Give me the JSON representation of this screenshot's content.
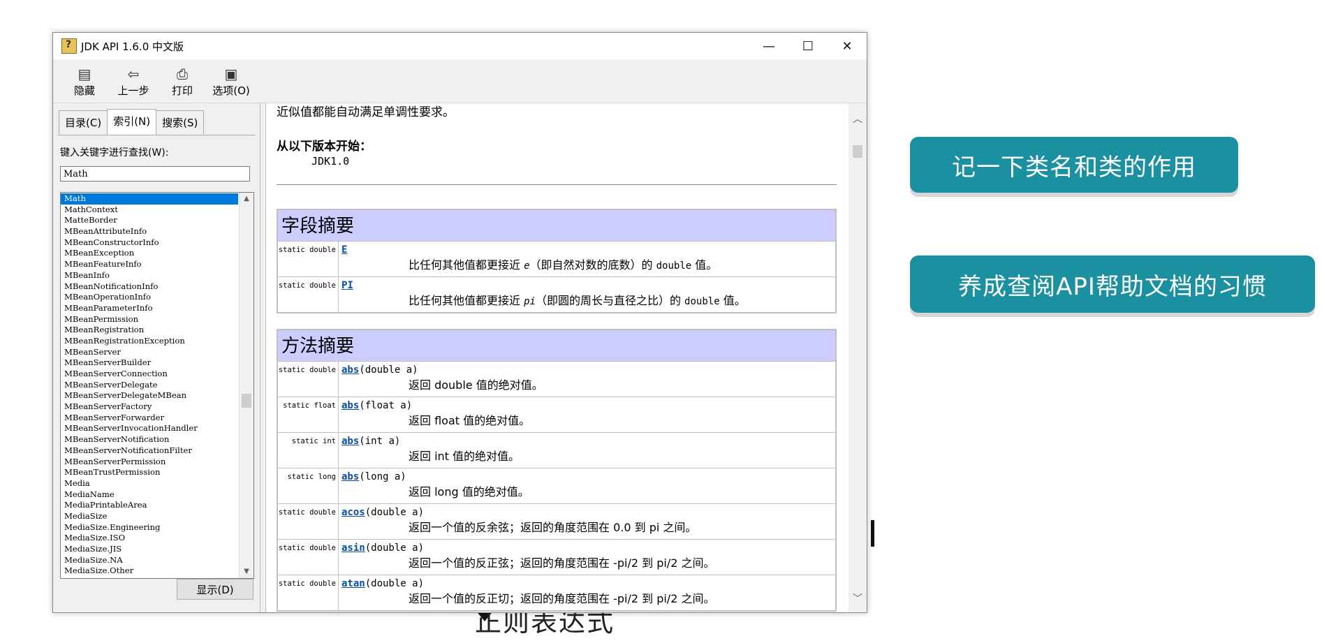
{
  "window": {
    "title": "JDK API 1.6.0 中文版",
    "controls": {
      "minimize": "—",
      "maximize": "☐",
      "close": "✕"
    }
  },
  "toolbar": [
    {
      "icon": "hide-icon",
      "label": "隐藏"
    },
    {
      "icon": "back-icon",
      "label": "上一步"
    },
    {
      "icon": "print-icon",
      "label": "打印"
    },
    {
      "icon": "options-icon",
      "label": "选项(O)"
    }
  ],
  "tabs": [
    {
      "label": "目录(C)",
      "active": false
    },
    {
      "label": "索引(N)",
      "active": true
    },
    {
      "label": "搜索(S)",
      "active": false
    }
  ],
  "index": {
    "search_label": "键入关键字进行查找(W):",
    "search_value": "Math",
    "items": [
      "Math",
      "MathContext",
      "MatteBorder",
      "MBeanAttributeInfo",
      "MBeanConstructorInfo",
      "MBeanException",
      "MBeanFeatureInfo",
      "MBeanInfo",
      "MBeanNotificationInfo",
      "MBeanOperationInfo",
      "MBeanParameterInfo",
      "MBeanPermission",
      "MBeanRegistration",
      "MBeanRegistrationException",
      "MBeanServer",
      "MBeanServerBuilder",
      "MBeanServerConnection",
      "MBeanServerDelegate",
      "MBeanServerDelegateMBean",
      "MBeanServerFactory",
      "MBeanServerForwarder",
      "MBeanServerInvocationHandler",
      "MBeanServerNotification",
      "MBeanServerNotificationFilter",
      "MBeanServerPermission",
      "MBeanTrustPermission",
      "Media",
      "MediaName",
      "MediaPrintableArea",
      "MediaSize",
      "MediaSize.Engineering",
      "MediaSize.ISO",
      "MediaSize.JIS",
      "MediaSize.NA",
      "MediaSize.Other"
    ],
    "selected": "Math",
    "show_button": "显示(D)"
  },
  "content": {
    "intro_line": "近似值都能自动满足单调性要求。",
    "since_label": "从以下版本开始：",
    "since_value": "JDK1.0",
    "field_summary": {
      "title": "字段摘要",
      "rows": [
        {
          "modifier": "static double",
          "name": "E",
          "params": "",
          "desc_pre": "比任何其他值都更接近 ",
          "desc_var": "e",
          "desc_mid": "（即自然对数的底数）的 ",
          "desc_code": "double",
          "desc_post": " 值。"
        },
        {
          "modifier": "static double",
          "name": "PI",
          "params": "",
          "desc_pre": "比任何其他值都更接近 ",
          "desc_var": "pi",
          "desc_mid": "（即圆的周长与直径之比）的 ",
          "desc_code": "double",
          "desc_post": " 值。"
        }
      ]
    },
    "method_summary": {
      "title": "方法摘要",
      "rows": [
        {
          "modifier": "static double",
          "name": "abs",
          "params": "(double a)",
          "desc": "返回 double 值的绝对值。"
        },
        {
          "modifier": "static float",
          "name": "abs",
          "params": "(float a)",
          "desc": "返回 float 值的绝对值。"
        },
        {
          "modifier": "static int",
          "name": "abs",
          "params": "(int a)",
          "desc": "返回 int 值的绝对值。"
        },
        {
          "modifier": "static long",
          "name": "abs",
          "params": "(long a)",
          "desc": "返回 long 值的绝对值。"
        },
        {
          "modifier": "static double",
          "name": "acos",
          "params": "(double a)",
          "desc": "返回一个值的反余弦；返回的角度范围在 0.0 到 pi 之间。"
        },
        {
          "modifier": "static double",
          "name": "asin",
          "params": "(double a)",
          "desc": "返回一个值的反正弦；返回的角度范围在 -pi/2 到 pi/2 之间。"
        },
        {
          "modifier": "static double",
          "name": "atan",
          "params": "(double a)",
          "desc": "返回一个值的反正切；返回的角度范围在 -pi/2 到 pi/2 之间。"
        }
      ]
    }
  },
  "callouts": [
    "记一下类名和类的作用",
    "养成查阅API帮助文档的习惯"
  ],
  "background_caption": "正则表达式",
  "colors": {
    "accent": "#1a90a0",
    "summary_header": "#ccccff",
    "selection": "#0078d7",
    "link": "#0a4ea0"
  }
}
